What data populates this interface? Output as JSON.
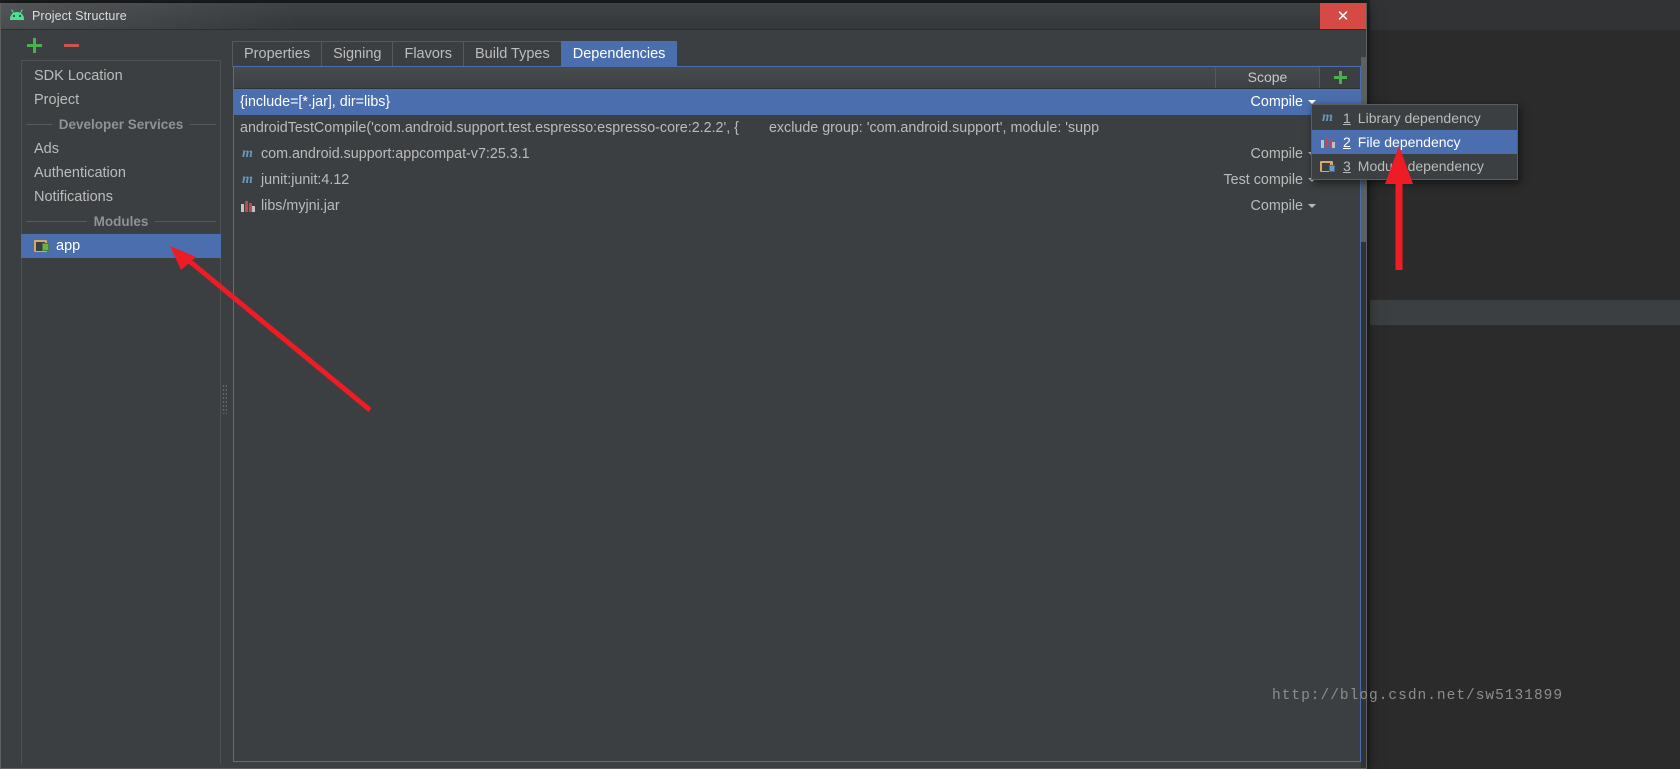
{
  "window": {
    "title": "Project Structure",
    "icon": "android-studio-icon",
    "close_label": "✕"
  },
  "left_pane": {
    "toolbar": {
      "add_label": "+",
      "remove_label": "−"
    },
    "items": [
      {
        "label": "SDK Location",
        "type": "item",
        "selected": false
      },
      {
        "label": "Project",
        "type": "item",
        "selected": false
      },
      {
        "label": "Developer Services",
        "type": "separator"
      },
      {
        "label": "Ads",
        "type": "item",
        "selected": false
      },
      {
        "label": "Authentication",
        "type": "item",
        "selected": false
      },
      {
        "label": "Notifications",
        "type": "item",
        "selected": false
      },
      {
        "label": "Modules",
        "type": "separator"
      },
      {
        "label": "app",
        "type": "item",
        "selected": true,
        "icon": "module-icon"
      }
    ]
  },
  "tabs": [
    {
      "label": "Properties",
      "active": false
    },
    {
      "label": "Signing",
      "active": false
    },
    {
      "label": "Flavors",
      "active": false
    },
    {
      "label": "Build Types",
      "active": false
    },
    {
      "label": "Dependencies",
      "active": true
    }
  ],
  "table": {
    "headers": {
      "name": "",
      "scope": "Scope"
    },
    "add_button_label": "+",
    "rows": [
      {
        "icon": "",
        "name": "{include=[*.jar], dir=libs}",
        "extra": "",
        "scope": "Compile",
        "has_caret": true,
        "selected": true
      },
      {
        "icon": "",
        "name": "androidTestCompile('com.android.support.test.espresso:espresso-core:2.2.2', {",
        "extra": "exclude group: 'com.android.support', module: 'supp",
        "scope": "",
        "has_caret": false,
        "selected": false
      },
      {
        "icon": "maven-icon",
        "name": "com.android.support:appcompat-v7:25.3.1",
        "extra": "",
        "scope": "Compile",
        "has_caret": true,
        "selected": false
      },
      {
        "icon": "maven-icon",
        "name": "junit:junit:4.12",
        "extra": "",
        "scope": "Test compile",
        "has_caret": true,
        "selected": false
      },
      {
        "icon": "jar-icon",
        "name": "libs/myjni.jar",
        "extra": "",
        "scope": "Compile",
        "has_caret": true,
        "selected": false
      }
    ]
  },
  "popup_menu": {
    "items": [
      {
        "icon": "maven-icon",
        "mnemonic": "1",
        "label": "Library dependency",
        "selected": false
      },
      {
        "icon": "jar-icon",
        "mnemonic": "2",
        "label": "File dependency",
        "selected": true
      },
      {
        "icon": "folder-icon",
        "mnemonic": "3",
        "label": "Module dependency",
        "selected": false
      }
    ]
  },
  "watermark": {
    "text": "http://blog.csdn.net/sw5131899"
  },
  "colors": {
    "selection_blue": "#4b6eaf",
    "panel_bg": "#3c3f41",
    "text": "#bbbbbb",
    "accent_green": "#4bb04b",
    "accent_red": "#c9564e",
    "annotation_red": "#ee1c25",
    "close_red": "#d64a46"
  }
}
